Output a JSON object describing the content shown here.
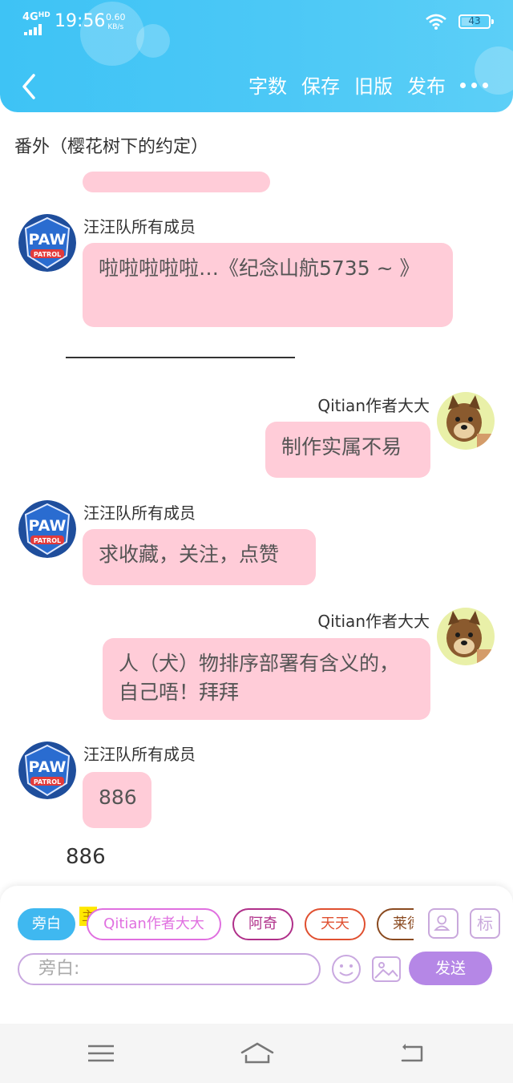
{
  "status_bar": {
    "network": "4G",
    "network_tag": "HD",
    "time": "19:56",
    "speed_value": "0.60",
    "speed_unit": "KB/s",
    "battery": "43",
    "battery_level": 0.43
  },
  "header": {
    "back_icon": "chevron-left-icon",
    "actions": [
      "字数",
      "保存",
      "旧版",
      "发布"
    ],
    "more_icon": "more-dots-icon",
    "background_color": "#4cc8f6"
  },
  "story_title": "番外（樱花树下的约定）",
  "messages": [
    {
      "sender": "汪汪队所有成员",
      "text": "啦啦啦啦啦…《纪念山航5735 ~ 》",
      "side": "left",
      "avatar": "paw-patrol-badge"
    },
    {
      "sender": "Qitian作者大大",
      "text": "制作实属不易",
      "side": "right",
      "avatar": "chase-dog"
    },
    {
      "sender": "汪汪队所有成员",
      "text": "求收藏，关注，点赞",
      "side": "left",
      "avatar": "paw-patrol-badge"
    },
    {
      "sender": "Qitian作者大大",
      "text": "人（犬）物排序部署有含义的，自己唔！拜拜",
      "side": "right",
      "avatar": "chase-dog"
    },
    {
      "sender": "汪汪队所有成员",
      "text": "886",
      "side": "left",
      "avatar": "paw-patrol-badge"
    }
  ],
  "narration": "886",
  "composer": {
    "roles": [
      {
        "label": "旁白",
        "color": "#3fb8f0",
        "active": true
      },
      {
        "label": "Qitian作者大大",
        "color": "#e070e0",
        "active": false
      },
      {
        "label": "阿奇",
        "color": "#b0308a",
        "active": false
      },
      {
        "label": "天天",
        "color": "#e05030",
        "active": false
      },
      {
        "label": "莱德",
        "color": "#8a4a20",
        "active": false
      }
    ],
    "owner_badge": "主",
    "contact_icon": "contact-card-icon",
    "tag_label": "标",
    "input_placeholder": "旁白:",
    "emoji_icon": "smiley-icon",
    "image_icon": "image-icon",
    "send_label": "发送",
    "send_color": "#b587e6"
  },
  "system_nav": {
    "menu_icon": "menu-lines-icon",
    "home_icon": "home-icon",
    "back_icon": "back-arrow-icon"
  },
  "colors": {
    "bubble": "#ffccd8",
    "accent": "#b587e6"
  }
}
